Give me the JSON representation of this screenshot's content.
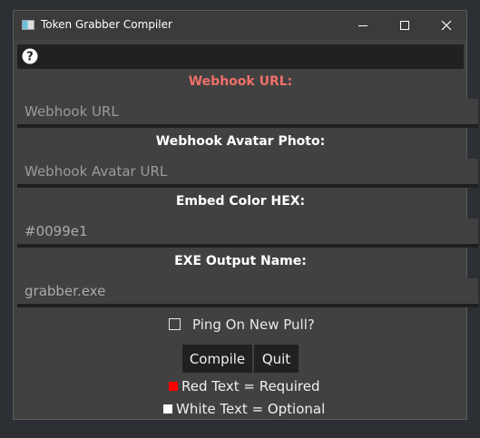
{
  "window": {
    "title": "Token Grabber Compiler",
    "icon": "app-window-icon",
    "controls": [
      "minimize-icon",
      "maximize-icon",
      "close-icon"
    ]
  },
  "help": {
    "icon": "help-icon",
    "glyph": "?"
  },
  "fields": [
    {
      "label": "Webhook URL:",
      "label_color": "#f0706a",
      "placeholder": "Webhook URL",
      "value": ""
    },
    {
      "label": "Webhook Avatar Photo:",
      "label_color": "#ffffff",
      "placeholder": "Webhook Avatar URL",
      "value": ""
    },
    {
      "label": "Embed Color HEX:",
      "label_color": "#ffffff",
      "placeholder": "",
      "value": "#0099e1"
    },
    {
      "label": "EXE Output Name:",
      "label_color": "#ffffff",
      "placeholder": "",
      "value": "grabber.exe"
    }
  ],
  "ping": {
    "label": "Ping On New Pull?",
    "checked": false
  },
  "buttons": {
    "compile": "Compile",
    "quit": "Quit"
  },
  "legend": [
    {
      "text": "Red Text = Required",
      "color": "#ff0000"
    },
    {
      "text": "White Text = Optional",
      "color": "#ffffff"
    }
  ]
}
